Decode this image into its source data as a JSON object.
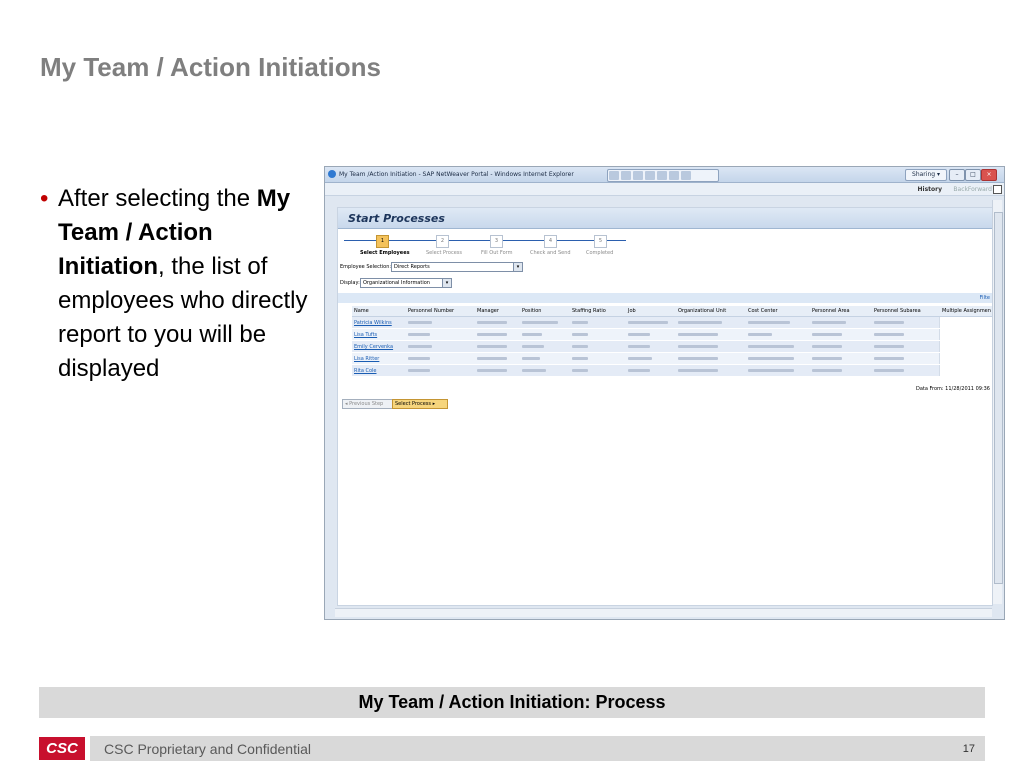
{
  "slide": {
    "title": "My Team / Action Initiations",
    "bullet": {
      "pre": "After selecting the",
      "bold": "My Team / Action Initiation",
      "post": ", the list of employees who directly report to you will be displayed"
    },
    "process_label": "My Team / Action Initiation: Process",
    "footer_text": "CSC Proprietary and Confidential",
    "page_number": "17",
    "logo_text": "CSC",
    "accent_color": "#c00000"
  },
  "browser": {
    "window_title": "My Team /Action Initiation - SAP NetWeaver Portal - Windows Internet Explorer",
    "sharing_label": "Sharing ▾",
    "nav": {
      "history": "History",
      "back": "Back",
      "forward": "Forward"
    }
  },
  "portal": {
    "header": "Start Processes",
    "steps": [
      {
        "num": "1",
        "label": "Select Employees",
        "active": true
      },
      {
        "num": "2",
        "label": "Select Process",
        "active": false
      },
      {
        "num": "3",
        "label": "Fill Out Form",
        "active": false
      },
      {
        "num": "4",
        "label": "Check and Send",
        "active": false
      },
      {
        "num": "5",
        "label": "Completed",
        "active": false
      }
    ],
    "employee_selection": {
      "label": "Employee Selection:",
      "value": "Direct Reports"
    },
    "display": {
      "label": "Display:",
      "value": "Organizational Information"
    },
    "filter_label": "Filte",
    "columns": [
      "Name",
      "Personnel Number",
      "Manager",
      "Position",
      "Staffing Ratio",
      "Job",
      "Organizational Unit",
      "Cost Center",
      "Personnel Area",
      "Personnel Subarea",
      "Multiple Assignmen"
    ],
    "rows": [
      "Patricia Wilkins",
      "Lisa Tufts",
      "Emily Cervenka",
      "Lisa Ritter",
      "Rita Cole"
    ],
    "data_from": "Data From: 11/28/2011 09:36",
    "buttons": {
      "previous": "◂ Previous Step",
      "select": "Select Process ▸"
    }
  }
}
